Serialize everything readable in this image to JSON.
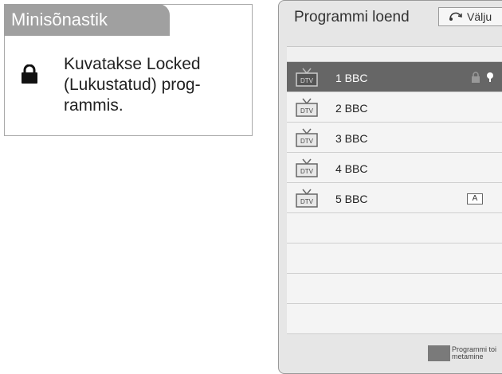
{
  "glossary": {
    "title": "Minisõnastik",
    "icon": "lock-icon",
    "lines": [
      "Kuvatakse Locked",
      "(Lukustatud) prog-",
      "rammis."
    ]
  },
  "panel": {
    "title": "Programmi loend",
    "exit_label": "Välju",
    "channels": [
      {
        "badge": "DTV",
        "label": "1 BBC",
        "selected": true,
        "locked": true,
        "favourite": true
      },
      {
        "badge": "DTV",
        "label": "2 BBC",
        "selected": false
      },
      {
        "badge": "DTV",
        "label": "3 BBC",
        "selected": false
      },
      {
        "badge": "DTV",
        "label": "4 BBC",
        "selected": false
      },
      {
        "badge": "DTV",
        "label": "5 BBC",
        "selected": false,
        "audio_badge": "A"
      }
    ],
    "bottom_label_1": "Programmi toi",
    "bottom_label_2": "metamine"
  },
  "colors": {
    "glossary_tab": "#a0a0a0",
    "selected_row": "#666666",
    "panel_bg": "#e6e6e6"
  }
}
